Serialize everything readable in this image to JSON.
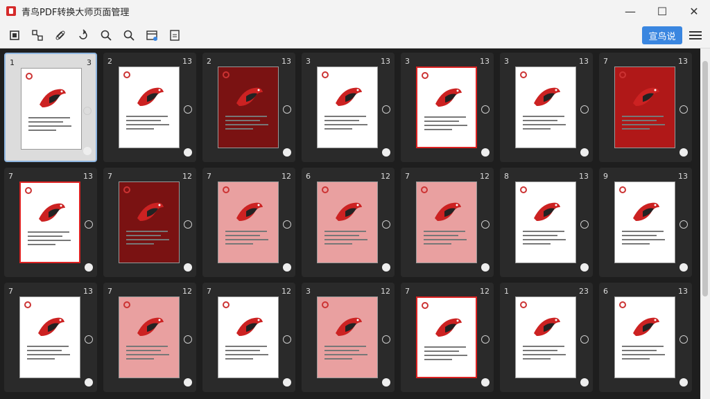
{
  "window": {
    "title": "青鸟PDF转换大师页面管理"
  },
  "toolbar": {
    "tools": [
      "insert-icon",
      "split-icon",
      "link-icon",
      "rotate-icon",
      "zoom-out-icon",
      "zoom-in-icon",
      "calendar-icon",
      "extract-icon"
    ],
    "primary_label": "宣鸟说"
  },
  "pages": [
    {
      "l": "1",
      "r": "3"
    },
    {
      "l": "2",
      "r": "13"
    },
    {
      "l": "2",
      "r": "13"
    },
    {
      "l": "3",
      "r": "13"
    },
    {
      "l": "3",
      "r": "13"
    },
    {
      "l": "3",
      "r": "13"
    },
    {
      "l": "7",
      "r": "13"
    },
    {
      "l": "7",
      "r": "13"
    },
    {
      "l": "7",
      "r": "12"
    },
    {
      "l": "7",
      "r": "12"
    },
    {
      "l": "6",
      "r": "12"
    },
    {
      "l": "7",
      "r": "12"
    },
    {
      "l": "8",
      "r": "13"
    },
    {
      "l": "9",
      "r": "13"
    },
    {
      "l": "7",
      "r": "13"
    },
    {
      "l": "7",
      "r": "12"
    },
    {
      "l": "7",
      "r": "12"
    },
    {
      "l": "3",
      "r": "12"
    },
    {
      "l": "7",
      "r": "12"
    },
    {
      "l": "1",
      "r": "23"
    },
    {
      "l": "6",
      "r": "13"
    }
  ]
}
